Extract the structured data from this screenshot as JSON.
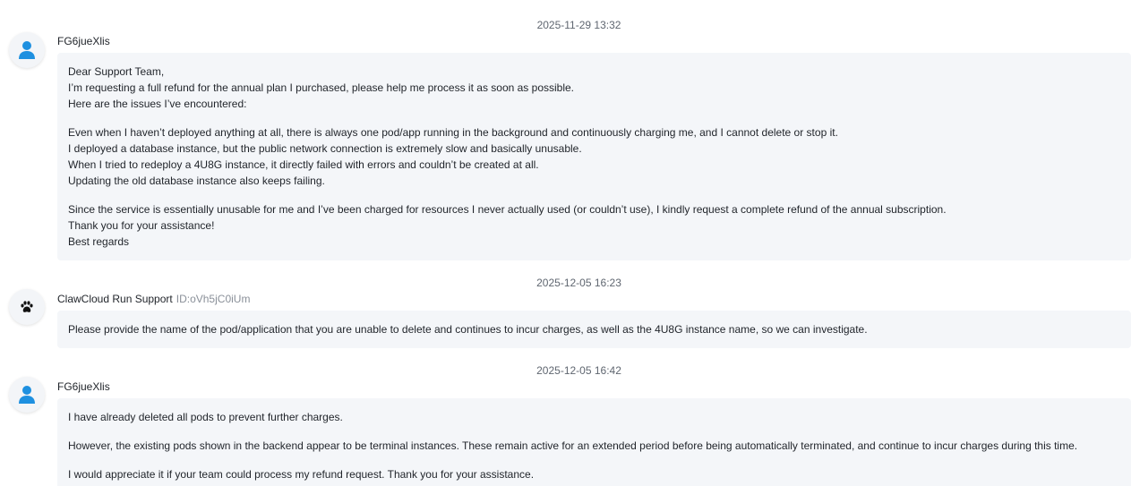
{
  "messages": [
    {
      "timestamp": "2025-11-29 13:32",
      "sender": "FG6jueXlis",
      "sender_id": "",
      "avatar_icon": "user-icon",
      "paragraphs": [
        [
          "Dear Support Team,",
          "I’m requesting a full refund for the annual plan I purchased, please help me process it as soon as possible.",
          "Here are the issues I’ve encountered:"
        ],
        [
          "Even when I haven’t deployed anything at all, there is always one pod/app running in the background and continuously charging me, and I cannot delete or stop it.",
          "I deployed a database instance, but the public network connection is extremely slow and basically unusable.",
          "When I tried to redeploy a 4U8G instance, it directly failed with errors and couldn’t be created at all.",
          "Updating the old database instance also keeps failing."
        ],
        [
          "Since the service is essentially unusable for me and I’ve been charged for resources I never actually used (or couldn’t use), I kindly request a complete refund of the annual subscription.",
          "Thank you for your assistance!",
          "Best regards"
        ]
      ]
    },
    {
      "timestamp": "2025-12-05 16:23",
      "sender": "ClawCloud Run Support",
      "sender_id": "ID:oVh5jC0iUm",
      "avatar_icon": "paw-icon",
      "paragraphs": [
        [
          "Please provide the name of the pod/application that you are unable to delete and continues to incur charges, as well as the 4U8G instance name, so we can investigate."
        ]
      ]
    },
    {
      "timestamp": "2025-12-05 16:42",
      "sender": "FG6jueXlis",
      "sender_id": "",
      "avatar_icon": "user-icon",
      "paragraphs": [
        [
          "I have already deleted all pods to prevent further charges."
        ],
        [
          "However, the existing pods shown in the backend appear to be terminal instances. These remain active for an extended period before being automatically terminated, and continue to incur charges during this time."
        ],
        [
          "I would appreciate it if your team could process my refund request. Thank you for your assistance."
        ]
      ]
    }
  ],
  "colors": {
    "user_avatar": "#1e90e0",
    "support_avatar": "#111111",
    "bubble_bg": "#f4f6f9"
  }
}
